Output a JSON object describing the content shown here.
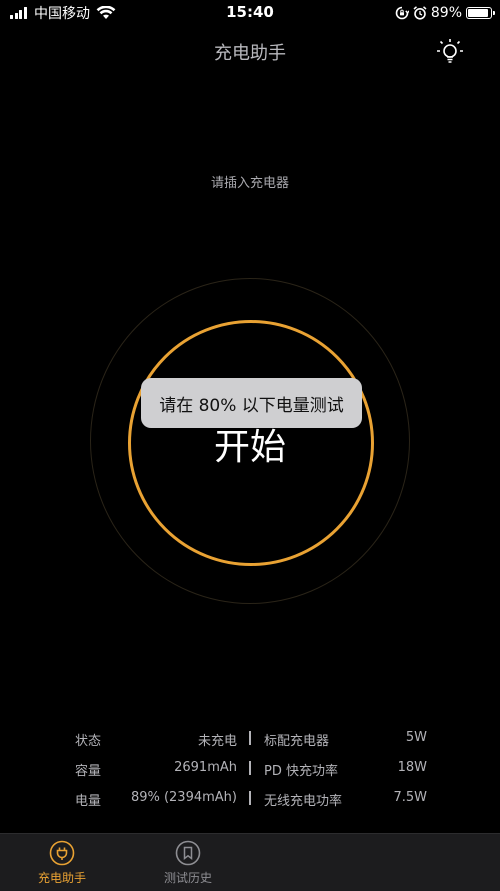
{
  "status_bar": {
    "carrier": "中国移动",
    "time": "15:40",
    "battery_percent": "89%",
    "battery_level": 0.89,
    "icons": [
      "signal-icon",
      "wifi-icon",
      "rotation-lock-icon",
      "alarm-icon",
      "battery-icon"
    ]
  },
  "nav": {
    "title": "充电助手",
    "right_icon": "light-bulb-icon"
  },
  "main": {
    "hint": "请插入充电器",
    "start_label": "开始",
    "toast": "请在 80% 以下电量测试"
  },
  "info": {
    "rows": [
      {
        "k1": "状态",
        "v1": "未充电",
        "k2": "标配充电器",
        "v2": "5W"
      },
      {
        "k1": "容量",
        "v1": "2691mAh",
        "k2": "PD 快充功率",
        "v2": "18W"
      },
      {
        "k1": "电量",
        "v1": "89% (2394mAh)",
        "k2": "无线充电功率",
        "v2": "7.5W"
      }
    ]
  },
  "tabs": [
    {
      "label": "充电助手",
      "icon": "plug-icon",
      "active": true
    },
    {
      "label": "测试历史",
      "icon": "bookmark-icon",
      "active": false
    }
  ],
  "colors": {
    "accent": "#e9a233",
    "background": "#000000",
    "tabbar": "#1c1c1e",
    "toast": "#cfcfd1"
  }
}
